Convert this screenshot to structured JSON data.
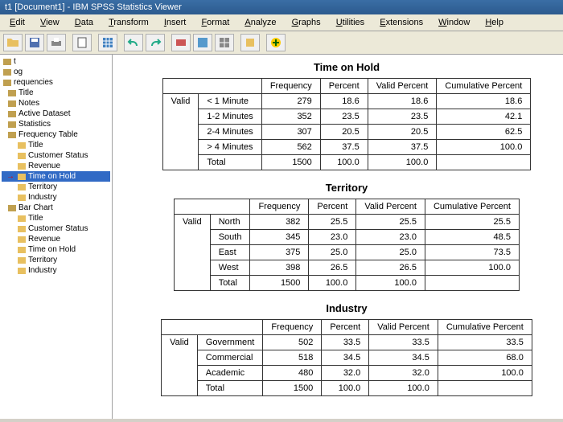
{
  "window": {
    "title": "t1 [Document1] - IBM SPSS Statistics Viewer"
  },
  "menu": {
    "items": [
      "Edit",
      "View",
      "Data",
      "Transform",
      "Insert",
      "Format",
      "Analyze",
      "Graphs",
      "Utilities",
      "Extensions",
      "Window",
      "Help"
    ]
  },
  "sidebar": {
    "items": [
      {
        "label": "t",
        "lvl": 0
      },
      {
        "label": "og",
        "lvl": 0
      },
      {
        "label": "requencies",
        "lvl": 0
      },
      {
        "label": "Title",
        "lvl": 1
      },
      {
        "label": "Notes",
        "lvl": 1
      },
      {
        "label": "Active Dataset",
        "lvl": 1
      },
      {
        "label": "Statistics",
        "lvl": 1
      },
      {
        "label": "Frequency Table",
        "lvl": 1
      },
      {
        "label": "Title",
        "lvl": 2
      },
      {
        "label": "Customer Status",
        "lvl": 2
      },
      {
        "label": "Revenue",
        "lvl": 2
      },
      {
        "label": "Time on Hold",
        "lvl": 2,
        "sel": true,
        "arrow": true
      },
      {
        "label": "Territory",
        "lvl": 2
      },
      {
        "label": "Industry",
        "lvl": 2
      },
      {
        "label": "Bar Chart",
        "lvl": 1
      },
      {
        "label": "Title",
        "lvl": 2
      },
      {
        "label": "Customer Status",
        "lvl": 2
      },
      {
        "label": "Revenue",
        "lvl": 2
      },
      {
        "label": "Time on Hold",
        "lvl": 2
      },
      {
        "label": "Territory",
        "lvl": 2
      },
      {
        "label": "Industry",
        "lvl": 2
      }
    ]
  },
  "tables": [
    {
      "title": "Time on Hold",
      "headers": [
        "Frequency",
        "Percent",
        "Valid Percent",
        "Cumulative Percent"
      ],
      "group": "Valid",
      "rows": [
        {
          "label": "< 1 Minute",
          "cells": [
            "279",
            "18.6",
            "18.6",
            "18.6"
          ]
        },
        {
          "label": "1-2 Minutes",
          "cells": [
            "352",
            "23.5",
            "23.5",
            "42.1"
          ]
        },
        {
          "label": "2-4 Minutes",
          "cells": [
            "307",
            "20.5",
            "20.5",
            "62.5"
          ]
        },
        {
          "label": "> 4 Minutes",
          "cells": [
            "562",
            "37.5",
            "37.5",
            "100.0"
          ]
        },
        {
          "label": "Total",
          "cells": [
            "1500",
            "100.0",
            "100.0",
            ""
          ]
        }
      ]
    },
    {
      "title": "Territory",
      "headers": [
        "Frequency",
        "Percent",
        "Valid Percent",
        "Cumulative Percent"
      ],
      "group": "Valid",
      "rows": [
        {
          "label": "North",
          "cells": [
            "382",
            "25.5",
            "25.5",
            "25.5"
          ]
        },
        {
          "label": "South",
          "cells": [
            "345",
            "23.0",
            "23.0",
            "48.5"
          ]
        },
        {
          "label": "East",
          "cells": [
            "375",
            "25.0",
            "25.0",
            "73.5"
          ]
        },
        {
          "label": "West",
          "cells": [
            "398",
            "26.5",
            "26.5",
            "100.0"
          ]
        },
        {
          "label": "Total",
          "cells": [
            "1500",
            "100.0",
            "100.0",
            ""
          ]
        }
      ]
    },
    {
      "title": "Industry",
      "headers": [
        "Frequency",
        "Percent",
        "Valid Percent",
        "Cumulative Percent"
      ],
      "group": "Valid",
      "rows": [
        {
          "label": "Government",
          "cells": [
            "502",
            "33.5",
            "33.5",
            "33.5"
          ]
        },
        {
          "label": "Commercial",
          "cells": [
            "518",
            "34.5",
            "34.5",
            "68.0"
          ]
        },
        {
          "label": "Academic",
          "cells": [
            "480",
            "32.0",
            "32.0",
            "100.0"
          ]
        },
        {
          "label": "Total",
          "cells": [
            "1500",
            "100.0",
            "100.0",
            ""
          ]
        }
      ]
    }
  ]
}
